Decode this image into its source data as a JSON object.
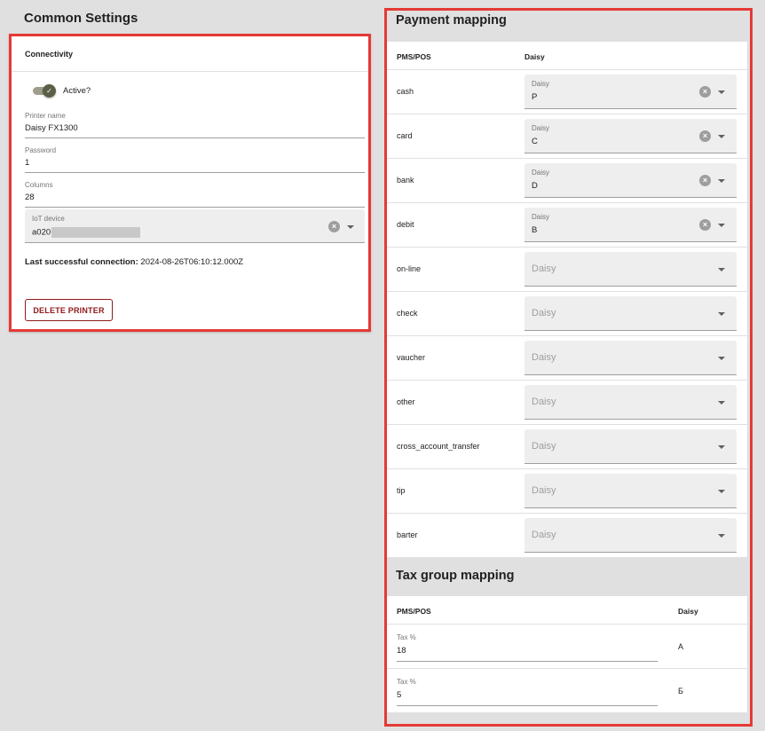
{
  "common_settings": {
    "title": "Common Settings",
    "card_header": "Connectivity",
    "active_label": "Active?",
    "active": true,
    "printer_name_label": "Printer name",
    "printer_name_value": "Daisy FX1300",
    "password_label": "Password",
    "password_value": "1",
    "columns_label": "Columns",
    "columns_value": "28",
    "iot_device_label": "IoT device",
    "iot_device_value_visible": "a020",
    "last_connection_label": "Last successful connection:",
    "last_connection_value": "2024-08-26T06:10:12.000Z",
    "delete_button": "DELETE PRINTER"
  },
  "payment_mapping": {
    "title": "Payment mapping",
    "col_pms": "PMS/POS",
    "col_daisy": "Daisy",
    "select_label": "Daisy",
    "rows": [
      {
        "name": "cash",
        "value": "P"
      },
      {
        "name": "card",
        "value": "C"
      },
      {
        "name": "bank",
        "value": "D"
      },
      {
        "name": "debit",
        "value": "B"
      },
      {
        "name": "on-line",
        "value": ""
      },
      {
        "name": "check",
        "value": ""
      },
      {
        "name": "vaucher",
        "value": ""
      },
      {
        "name": "other",
        "value": ""
      },
      {
        "name": "cross_account_transfer",
        "value": ""
      },
      {
        "name": "tip",
        "value": ""
      },
      {
        "name": "barter",
        "value": ""
      }
    ]
  },
  "tax_group_mapping": {
    "title": "Tax group mapping",
    "col_pms": "PMS/POS",
    "col_daisy": "Daisy",
    "rows": [
      {
        "label": "Tax %",
        "value": "18",
        "code": "А"
      },
      {
        "label": "Tax %",
        "value": "5",
        "code": "Б"
      }
    ]
  },
  "colors": {
    "highlight_border": "#e53935",
    "toggle_active": "#5a5f47",
    "delete_button": "#8e1a1a"
  }
}
